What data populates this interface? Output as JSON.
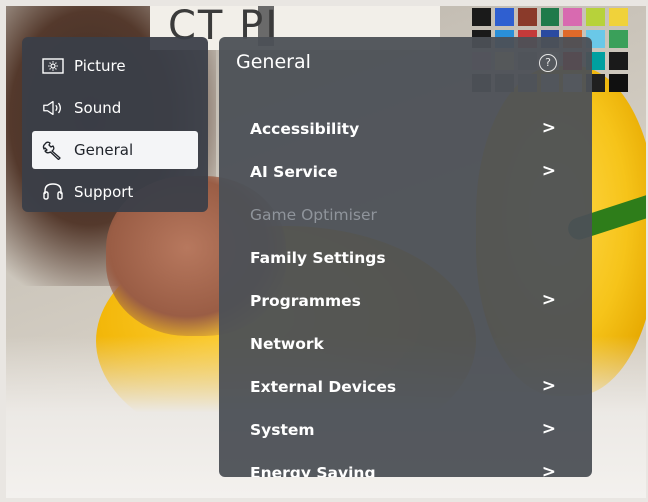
{
  "background": {
    "card_text": "CT   PI",
    "swatches": [
      "#1a1a1a",
      "#2f5fd0",
      "#8a3a2a",
      "#1f7a4a",
      "#d86ab0",
      "#b7d23a",
      "#f0d23a",
      "#1a1a1a",
      "#2a8fd8",
      "#c43a3a",
      "#2a4aa0",
      "#e06a2a",
      "#6ac8e8",
      "#3aa05a",
      "#d8a0c8",
      "#f0e0a0",
      "#a0a0a0",
      "#e8e8e8",
      "#ff0000",
      "#00a0a0",
      "#1a1a1a",
      "#3a3a3a",
      "#606060",
      "#909090",
      "#c0c0c0",
      "#e0e0e0",
      "#202020",
      "#101010"
    ]
  },
  "left_menu": {
    "items": [
      {
        "label": "Picture",
        "icon": "picture-icon"
      },
      {
        "label": "Sound",
        "icon": "sound-icon"
      },
      {
        "label": "General",
        "icon": "wrench-icon"
      },
      {
        "label": "Support",
        "icon": "headset-icon"
      }
    ]
  },
  "panel": {
    "title": "General",
    "help_symbol": "?",
    "items": [
      {
        "label": "Accessibility",
        "chevron": ">"
      },
      {
        "label": "AI Service",
        "chevron": ">"
      },
      {
        "label": "Game Optimiser",
        "chevron": ""
      },
      {
        "label": "Family Settings",
        "chevron": ""
      },
      {
        "label": "Programmes",
        "chevron": ">"
      },
      {
        "label": "Network",
        "chevron": ""
      },
      {
        "label": "External Devices",
        "chevron": ">"
      },
      {
        "label": "System",
        "chevron": ">"
      },
      {
        "label": "Energy Saving",
        "chevron": ">"
      }
    ]
  }
}
